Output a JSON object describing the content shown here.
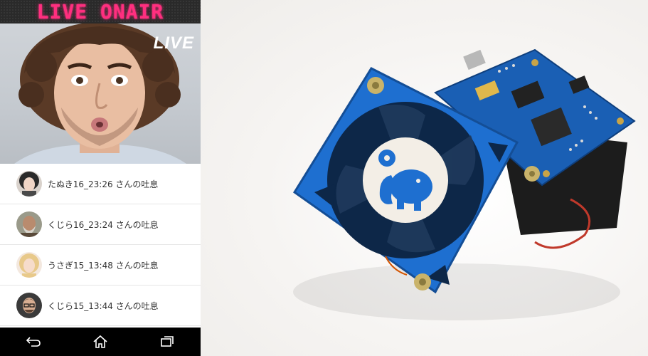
{
  "phone": {
    "header_title": "LIVE ONAIR",
    "live_label": "LIVE",
    "posts": [
      {
        "text": "たぬき16_23:26 さんの吐息"
      },
      {
        "text": "くじら16_23:24 さんの吐息"
      },
      {
        "text": "うさぎ15_13:48 さんの吐息"
      },
      {
        "text": "くじら15_13:44 さんの吐息"
      }
    ],
    "nav": [
      "back-icon",
      "home-icon",
      "recent-apps-icon"
    ]
  },
  "colors": {
    "led": "#ff2f7f",
    "pcb_blue": "#1a5fb4",
    "fan_blue": "#1e6fd0"
  }
}
